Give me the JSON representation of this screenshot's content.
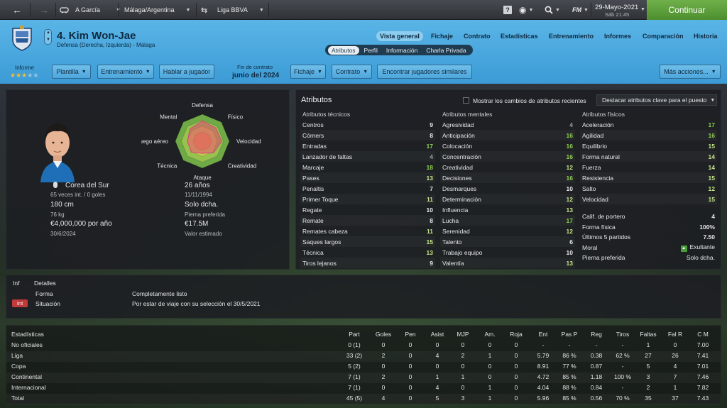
{
  "topbar": {
    "back_label": "",
    "manager": "A García",
    "club_location": "Málaga/Argentina",
    "competition": "Liga BBVA",
    "help": "?",
    "fm_label": "FM",
    "date": "29-Mayo-2021",
    "day_time": "Sáb 21:45",
    "continue_label": "Continuar"
  },
  "player": {
    "name": "4. Kim Won-Jae",
    "position": "Defensa (Derecha, Izquierda) - Málaga",
    "nationality": "Corea del Sur",
    "caps": "65 veces int. / 0 goles",
    "height": "180 cm",
    "weight": "76 kg",
    "wage": "€4,000,000 por año",
    "contract_date": "30/6/2024",
    "age": "26 años",
    "dob": "11/11/1994",
    "foot": "Solo dcha.",
    "foot_label": "Pierna preferida",
    "value": "€17.5M",
    "value_label": "Valor estimado"
  },
  "nav": {
    "tabs": [
      "Vista general",
      "Fichaje",
      "Contrato",
      "Estadísticas",
      "Entrenamiento",
      "Informes",
      "Comparación",
      "Historia"
    ],
    "subtabs": [
      "Atributos",
      "Perfil",
      "Información",
      "Charla Privada"
    ]
  },
  "header": {
    "informe": "Informe",
    "stars_on": 3,
    "stars_total": 5,
    "contract_label": "Fin de contrato",
    "contract_value": "junio del 2024",
    "buttons": [
      "Plantilla",
      "Entrenamiento",
      "Hablar a jugador",
      "Fichaje",
      "Contrato",
      "Encontrar jugadores similares",
      "Más acciones..."
    ]
  },
  "radar": {
    "labels": [
      "Defensa",
      "Físico",
      "Velocidad",
      "Creatividad",
      "Ataque",
      "Técnica",
      "Juego aéreo",
      "Mental"
    ],
    "values": [
      0.75,
      0.7,
      0.72,
      0.6,
      0.45,
      0.58,
      0.55,
      0.65
    ]
  },
  "attributes": {
    "title": "Atributos",
    "show_changes": "Mostrar los cambios de atributos recientes",
    "highlight": "Destacar atributos clave para el puesto",
    "technical_title": "Atributos técnicos",
    "mental_title": "Atributos mentales",
    "physical_title": "Atributos físicos",
    "technical": [
      {
        "name": "Centros",
        "value": "9"
      },
      {
        "name": "Córners",
        "value": "8"
      },
      {
        "name": "Entradas",
        "value": "17"
      },
      {
        "name": "Lanzador de faltas",
        "value": "4"
      },
      {
        "name": "Marcaje",
        "value": "18"
      },
      {
        "name": "Pases",
        "value": "13"
      },
      {
        "name": "Penaltis",
        "value": "7"
      },
      {
        "name": "Primer Toque",
        "value": "11"
      },
      {
        "name": "Regate",
        "value": "10"
      },
      {
        "name": "Remate",
        "value": "8"
      },
      {
        "name": "Remates cabeza",
        "value": "11"
      },
      {
        "name": "Saques largos",
        "value": "15"
      },
      {
        "name": "Técnica",
        "value": "13"
      },
      {
        "name": "Tiros lejanos",
        "value": "9"
      }
    ],
    "mental": [
      {
        "name": "Agresividad",
        "value": "4"
      },
      {
        "name": "Anticipación",
        "value": "16"
      },
      {
        "name": "Colocación",
        "value": "16"
      },
      {
        "name": "Concentración",
        "value": "16"
      },
      {
        "name": "Creatividad",
        "value": "12"
      },
      {
        "name": "Decisiones",
        "value": "16"
      },
      {
        "name": "Desmarques",
        "value": "10"
      },
      {
        "name": "Determinación",
        "value": "12"
      },
      {
        "name": "Influencia",
        "value": "13"
      },
      {
        "name": "Lucha",
        "value": "17"
      },
      {
        "name": "Serenidad",
        "value": "12"
      },
      {
        "name": "Talento",
        "value": "6"
      },
      {
        "name": "Trabajo equipo",
        "value": "10"
      },
      {
        "name": "Valentía",
        "value": "13"
      }
    ],
    "physical": [
      {
        "name": "Aceleración",
        "value": "17"
      },
      {
        "name": "Agilidad",
        "value": "16"
      },
      {
        "name": "Equilibrio",
        "value": "15"
      },
      {
        "name": "Forma natural",
        "value": "14"
      },
      {
        "name": "Fuerza",
        "value": "14"
      },
      {
        "name": "Resistencia",
        "value": "15"
      },
      {
        "name": "Salto",
        "value": "12"
      },
      {
        "name": "Velocidad",
        "value": "15"
      }
    ],
    "extra": [
      {
        "name": "Calif. de portero",
        "value": "4"
      },
      {
        "name": "Forma física",
        "value": "100%"
      },
      {
        "name": "Últimos 5 partidos",
        "value": "7.50"
      },
      {
        "name": "Moral",
        "value": "Exultante"
      },
      {
        "name": "Pierna preferida",
        "value": "Solo dcha."
      }
    ]
  },
  "details": {
    "col_inf": "Inf",
    "col_detalles": "Detalles",
    "rows": [
      {
        "badge": "",
        "label": "Forma",
        "value": "Completamente listo"
      },
      {
        "badge": "Int",
        "label": "Situación",
        "value": "Por estar de viaje con su selección el 30/5/2021"
      }
    ]
  },
  "stats": {
    "title": "Estadísticas",
    "headers": [
      "Part",
      "Goles",
      "Pen",
      "Asist",
      "MJP",
      "Am.",
      "Roja",
      "Ent",
      "Pas P",
      "Reg",
      "Tiros",
      "Faltas",
      "Fal R",
      "C M"
    ],
    "rows": [
      {
        "name": "No oficiales",
        "cells": [
          "0 (1)",
          "0",
          "0",
          "0",
          "0",
          "0",
          "0",
          "-",
          "-",
          "-",
          "-",
          "1",
          "0",
          "7.00"
        ]
      },
      {
        "name": "Liga",
        "cells": [
          "33 (2)",
          "2",
          "0",
          "4",
          "2",
          "1",
          "0",
          "5.79",
          "86 %",
          "0.38",
          "62 %",
          "27",
          "26",
          "7.41"
        ]
      },
      {
        "name": "Copa",
        "cells": [
          "5 (2)",
          "0",
          "0",
          "0",
          "0",
          "0",
          "0",
          "8.91",
          "77 %",
          "0.87",
          "-",
          "5",
          "4",
          "7.01"
        ]
      },
      {
        "name": "Continental",
        "cells": [
          "7 (1)",
          "2",
          "0",
          "1",
          "1",
          "0",
          "0",
          "4.72",
          "85 %",
          "1.18",
          "100 %",
          "3",
          "7",
          "7.46"
        ]
      },
      {
        "name": "Internacional",
        "cells": [
          "7 (1)",
          "0",
          "0",
          "4",
          "0",
          "1",
          "0",
          "4.04",
          "88 %",
          "0.84",
          "-",
          "2",
          "1",
          "7.82"
        ]
      },
      {
        "name": "Total",
        "cells": [
          "45 (5)",
          "4",
          "0",
          "5",
          "3",
          "1",
          "0",
          "5.96",
          "85 %",
          "0.56",
          "70 %",
          "35",
          "37",
          "7.43"
        ]
      }
    ]
  },
  "colors": {
    "accent": "#4aa8df",
    "continue": "#5a9d38",
    "attr_high": "#8fd04f",
    "int_badge": "#c0393b"
  }
}
